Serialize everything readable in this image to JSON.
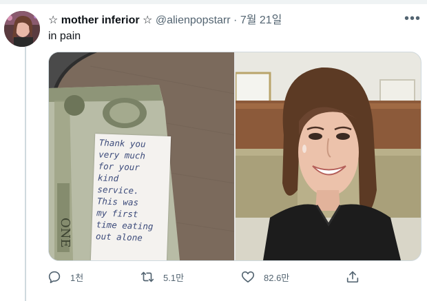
{
  "tweet": {
    "display_name": "☆ mother inferior ☆",
    "handle": "@alienpopstarr",
    "separator": "·",
    "date": "7월 21일",
    "text": "in pain",
    "more_glyph": "•••"
  },
  "media": {
    "note_lines": [
      "Thank you",
      "very much",
      "for your",
      "kind",
      "service.",
      "This was",
      "my first",
      "time eating",
      "out alone"
    ]
  },
  "actions": {
    "reply_count": "1천",
    "retweet_count": "5.1만",
    "like_count": "82.6만"
  },
  "icons": {
    "reply": "reply-icon",
    "retweet": "retweet-icon",
    "like": "heart-icon",
    "share": "share-icon",
    "more": "more-icon"
  },
  "colors": {
    "secondary_text": "#536471",
    "primary_text": "#0f1419",
    "border": "#cfd9de"
  }
}
